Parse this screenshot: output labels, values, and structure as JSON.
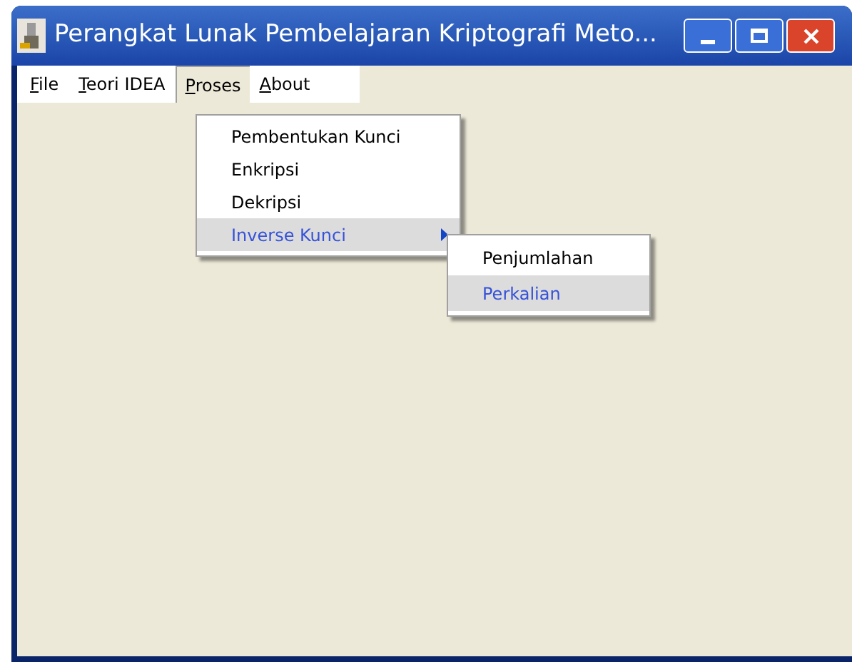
{
  "window": {
    "title": "Perangkat Lunak Pembelajaran Kriptografi Meto..."
  },
  "menu_bar": [
    {
      "label": "File",
      "underline_first": true,
      "selected": false
    },
    {
      "label": "Teori IDEA",
      "underline_first": true,
      "selected": false
    },
    {
      "label": "Proses",
      "underline_first": true,
      "selected": true
    },
    {
      "label": "About",
      "underline_first": true,
      "selected": false
    }
  ],
  "dropdown": [
    {
      "label": "Pembentukan Kunci",
      "selected": false,
      "submenu": false
    },
    {
      "label": "Enkripsi",
      "selected": false,
      "submenu": false
    },
    {
      "label": "Dekripsi",
      "selected": false,
      "submenu": false
    },
    {
      "label": "Inverse Kunci",
      "selected": true,
      "submenu": true
    }
  ],
  "submenu": [
    {
      "label": "Penjumlahan",
      "selected": false
    },
    {
      "label": "Perkalian",
      "selected": true
    }
  ]
}
